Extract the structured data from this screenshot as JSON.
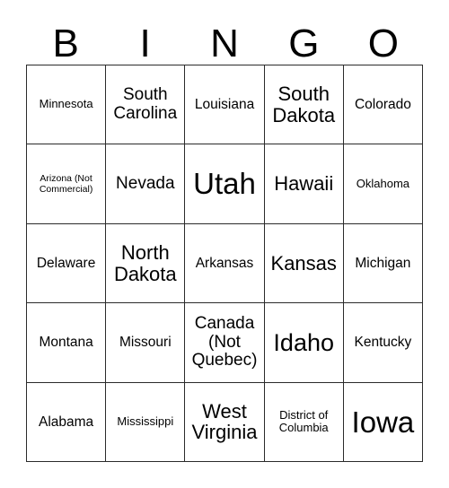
{
  "card": {
    "title": "BINGO",
    "header_letters": [
      "B",
      "I",
      "N",
      "G",
      "O"
    ],
    "grid_line_color": "#2b2b2b",
    "background_color": "#ffffff",
    "text_color": "#000000",
    "columns": 5,
    "rows": 5,
    "cells": [
      [
        {
          "text": "Minnesota",
          "size": "sm"
        },
        {
          "text": "South\nCarolina",
          "size": "lg"
        },
        {
          "text": "Louisiana",
          "size": "md"
        },
        {
          "text": "South\nDakota",
          "size": "xl"
        },
        {
          "text": "Colorado",
          "size": "md"
        }
      ],
      [
        {
          "text": "Arizona (Not\nCommercial)",
          "size": "xs"
        },
        {
          "text": "Nevada",
          "size": "lg"
        },
        {
          "text": "Utah",
          "size": "huge"
        },
        {
          "text": "Hawaii",
          "size": "xl"
        },
        {
          "text": "Oklahoma",
          "size": "sm"
        }
      ],
      [
        {
          "text": "Delaware",
          "size": "md"
        },
        {
          "text": "North\nDakota",
          "size": "xl"
        },
        {
          "text": "Arkansas",
          "size": "md"
        },
        {
          "text": "Kansas",
          "size": "xl"
        },
        {
          "text": "Michigan",
          "size": "md"
        }
      ],
      [
        {
          "text": "Montana",
          "size": "md"
        },
        {
          "text": "Missouri",
          "size": "md"
        },
        {
          "text": "Canada\n(Not\nQuebec)",
          "size": "lg"
        },
        {
          "text": "Idaho",
          "size": "xxl"
        },
        {
          "text": "Kentucky",
          "size": "md"
        }
      ],
      [
        {
          "text": "Alabama",
          "size": "md"
        },
        {
          "text": "Mississippi",
          "size": "sm"
        },
        {
          "text": "West\nVirginia",
          "size": "xl"
        },
        {
          "text": "District of\nColumbia",
          "size": "sm"
        },
        {
          "text": "Iowa",
          "size": "huge"
        }
      ]
    ]
  }
}
